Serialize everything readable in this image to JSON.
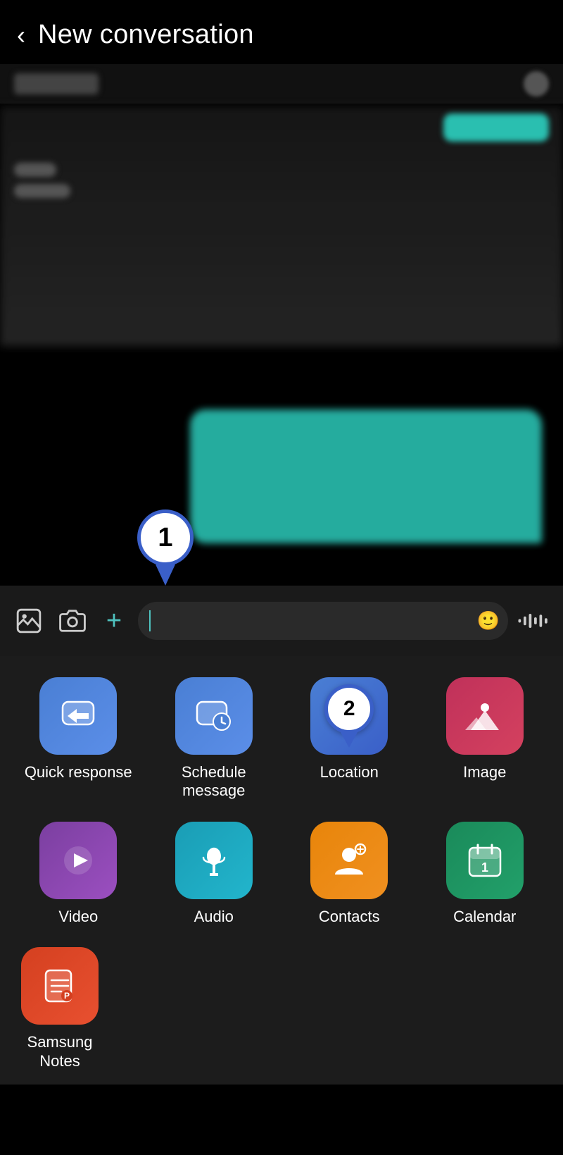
{
  "header": {
    "back_label": "‹",
    "title": "New conversation"
  },
  "input_bar": {
    "placeholder": "",
    "emoji_icon": "😊",
    "plus_icon": "+",
    "voice_icon": "🎙"
  },
  "pins": {
    "pin1_number": "1",
    "pin2_number": "2"
  },
  "apps": {
    "row1": [
      {
        "id": "quick-response",
        "label": "Quick response"
      },
      {
        "id": "schedule-message",
        "label": "Schedule message"
      },
      {
        "id": "location",
        "label": "Location"
      },
      {
        "id": "image",
        "label": "Image"
      }
    ],
    "row2": [
      {
        "id": "video",
        "label": "Video"
      },
      {
        "id": "audio",
        "label": "Audio"
      },
      {
        "id": "contacts",
        "label": "Contacts"
      },
      {
        "id": "calendar",
        "label": "Calendar"
      }
    ],
    "row3": [
      {
        "id": "samsung-notes",
        "label": "Samsung Notes"
      }
    ]
  }
}
